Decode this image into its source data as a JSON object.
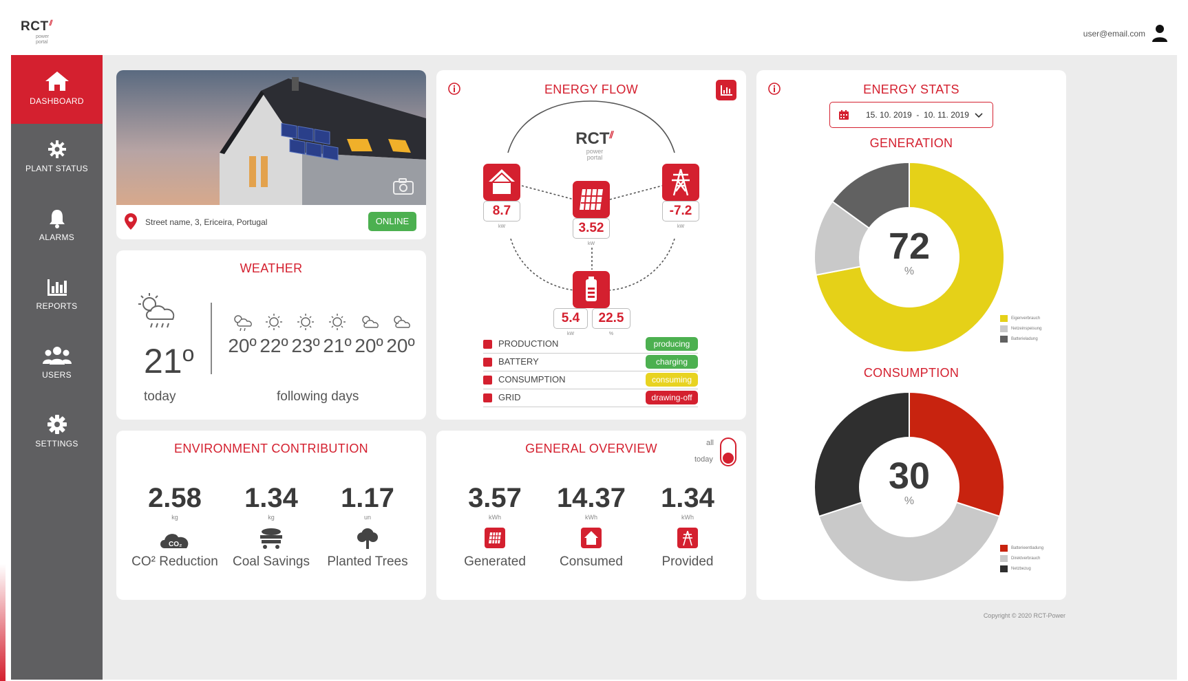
{
  "brand": {
    "name": "RCT",
    "sub_line1": "power",
    "sub_line2": "portal"
  },
  "header": {
    "user_email": "user@email.com"
  },
  "sidebar": {
    "items": [
      {
        "label": "DASHBOARD",
        "icon": "home-icon",
        "active": true
      },
      {
        "label": "PLANT STATUS",
        "icon": "gear-icon"
      },
      {
        "label": "ALARMS",
        "icon": "bell-icon"
      },
      {
        "label": "REPORTS",
        "icon": "bar-chart-icon"
      },
      {
        "label": "USERS",
        "icon": "users-icon"
      },
      {
        "label": "SETTINGS",
        "icon": "settings-icon"
      }
    ]
  },
  "plant": {
    "address": "Street name, 3, Ericeira, Portugal",
    "status": "ONLINE"
  },
  "weather": {
    "title": "WEATHER",
    "today_temp": "21",
    "today_label": "today",
    "following_label": "following days",
    "days": [
      "20º",
      "22º",
      "23º",
      "21º",
      "20º",
      "20º"
    ]
  },
  "environment": {
    "title": "ENVIRONMENT CONTRIBUTION",
    "items": [
      {
        "value": "2.58",
        "unit": "kg",
        "label": "CO² Reduction",
        "icon": "co2-cloud-icon"
      },
      {
        "value": "1.34",
        "unit": "kg",
        "label": "Coal Savings",
        "icon": "coal-cart-icon"
      },
      {
        "value": "1.17",
        "unit": "un",
        "label": "Planted Trees",
        "icon": "tree-icon"
      }
    ]
  },
  "energy_flow": {
    "title": "ENERGY FLOW",
    "house_value": "8.7",
    "house_unit": "kW",
    "solar_value": "3.52",
    "solar_unit": "kW",
    "grid_value": "-7.2",
    "grid_unit": "kW",
    "battery_power": "5.4",
    "battery_power_unit": "kW",
    "battery_soc": "22.5",
    "battery_soc_unit": "%",
    "legend": [
      {
        "name": "PRODUCTION",
        "status": "producing",
        "color": "#4caf50"
      },
      {
        "name": "BATTERY",
        "status": "charging",
        "color": "#4caf50"
      },
      {
        "name": "CONSUMPTION",
        "status": "consuming",
        "color": "#e8d321"
      },
      {
        "name": "GRID",
        "status": "drawing-off",
        "color": "#d4202f"
      }
    ]
  },
  "overview": {
    "title": "GENERAL OVERVIEW",
    "toggle_all": "all",
    "toggle_today": "today",
    "items": [
      {
        "value": "3.57",
        "unit": "kWh",
        "label": "Generated",
        "icon": "solar-panel-icon"
      },
      {
        "value": "14.37",
        "unit": "kWh",
        "label": "Consumed",
        "icon": "house-icon"
      },
      {
        "value": "1.34",
        "unit": "kWh",
        "label": "Provided",
        "icon": "grid-tower-icon"
      }
    ]
  },
  "stats": {
    "title": "ENERGY STATS",
    "date_range": "15. 10. 2019  -  10. 11. 2019",
    "generation_title": "GENERATION",
    "generation_value": "72",
    "generation_unit": "%",
    "consumption_title": "CONSUMPTION",
    "consumption_value": "30",
    "consumption_unit": "%"
  },
  "chart_data": [
    {
      "type": "pie",
      "title": "GENERATION",
      "center_label": "72",
      "slices": [
        {
          "name": "Eigenverbrauch",
          "value": 72,
          "color": "#e5d118"
        },
        {
          "name": "Netzeinspeisung",
          "value": 13,
          "color": "#c9c9c9"
        },
        {
          "name": "Batterieladung",
          "value": 15,
          "color": "#616161"
        }
      ],
      "legend_position": "right"
    },
    {
      "type": "pie",
      "title": "CONSUMPTION",
      "center_label": "30",
      "slices": [
        {
          "name": "Batterieentladung",
          "value": 30,
          "color": "#c8230f"
        },
        {
          "name": "Direktverbrauch",
          "value": 40,
          "color": "#c9c9c9"
        },
        {
          "name": "Netzbezug",
          "value": 30,
          "color": "#2f2f2f"
        }
      ],
      "legend_position": "right"
    }
  ],
  "footer": {
    "copyright": "Copyright © 2020 RCT-Power"
  }
}
